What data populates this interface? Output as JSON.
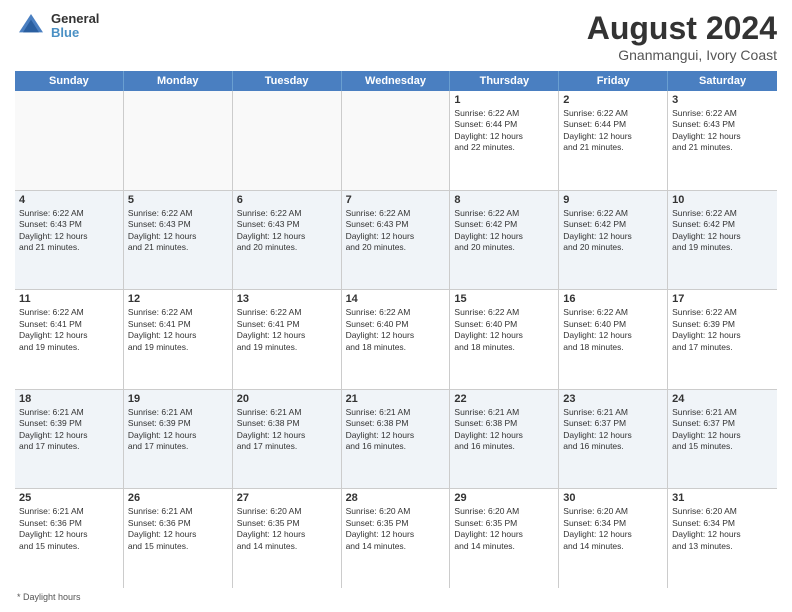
{
  "header": {
    "logo_line1": "General",
    "logo_line2": "Blue",
    "title": "August 2024",
    "subtitle": "Gnanmangui, Ivory Coast"
  },
  "days_of_week": [
    "Sunday",
    "Monday",
    "Tuesday",
    "Wednesday",
    "Thursday",
    "Friday",
    "Saturday"
  ],
  "weeks": [
    [
      {
        "day": "",
        "info": ""
      },
      {
        "day": "",
        "info": ""
      },
      {
        "day": "",
        "info": ""
      },
      {
        "day": "",
        "info": ""
      },
      {
        "day": "1",
        "info": "Sunrise: 6:22 AM\nSunset: 6:44 PM\nDaylight: 12 hours\nand 22 minutes."
      },
      {
        "day": "2",
        "info": "Sunrise: 6:22 AM\nSunset: 6:44 PM\nDaylight: 12 hours\nand 21 minutes."
      },
      {
        "day": "3",
        "info": "Sunrise: 6:22 AM\nSunset: 6:43 PM\nDaylight: 12 hours\nand 21 minutes."
      }
    ],
    [
      {
        "day": "4",
        "info": "Sunrise: 6:22 AM\nSunset: 6:43 PM\nDaylight: 12 hours\nand 21 minutes."
      },
      {
        "day": "5",
        "info": "Sunrise: 6:22 AM\nSunset: 6:43 PM\nDaylight: 12 hours\nand 21 minutes."
      },
      {
        "day": "6",
        "info": "Sunrise: 6:22 AM\nSunset: 6:43 PM\nDaylight: 12 hours\nand 20 minutes."
      },
      {
        "day": "7",
        "info": "Sunrise: 6:22 AM\nSunset: 6:43 PM\nDaylight: 12 hours\nand 20 minutes."
      },
      {
        "day": "8",
        "info": "Sunrise: 6:22 AM\nSunset: 6:42 PM\nDaylight: 12 hours\nand 20 minutes."
      },
      {
        "day": "9",
        "info": "Sunrise: 6:22 AM\nSunset: 6:42 PM\nDaylight: 12 hours\nand 20 minutes."
      },
      {
        "day": "10",
        "info": "Sunrise: 6:22 AM\nSunset: 6:42 PM\nDaylight: 12 hours\nand 19 minutes."
      }
    ],
    [
      {
        "day": "11",
        "info": "Sunrise: 6:22 AM\nSunset: 6:41 PM\nDaylight: 12 hours\nand 19 minutes."
      },
      {
        "day": "12",
        "info": "Sunrise: 6:22 AM\nSunset: 6:41 PM\nDaylight: 12 hours\nand 19 minutes."
      },
      {
        "day": "13",
        "info": "Sunrise: 6:22 AM\nSunset: 6:41 PM\nDaylight: 12 hours\nand 19 minutes."
      },
      {
        "day": "14",
        "info": "Sunrise: 6:22 AM\nSunset: 6:40 PM\nDaylight: 12 hours\nand 18 minutes."
      },
      {
        "day": "15",
        "info": "Sunrise: 6:22 AM\nSunset: 6:40 PM\nDaylight: 12 hours\nand 18 minutes."
      },
      {
        "day": "16",
        "info": "Sunrise: 6:22 AM\nSunset: 6:40 PM\nDaylight: 12 hours\nand 18 minutes."
      },
      {
        "day": "17",
        "info": "Sunrise: 6:22 AM\nSunset: 6:39 PM\nDaylight: 12 hours\nand 17 minutes."
      }
    ],
    [
      {
        "day": "18",
        "info": "Sunrise: 6:21 AM\nSunset: 6:39 PM\nDaylight: 12 hours\nand 17 minutes."
      },
      {
        "day": "19",
        "info": "Sunrise: 6:21 AM\nSunset: 6:39 PM\nDaylight: 12 hours\nand 17 minutes."
      },
      {
        "day": "20",
        "info": "Sunrise: 6:21 AM\nSunset: 6:38 PM\nDaylight: 12 hours\nand 17 minutes."
      },
      {
        "day": "21",
        "info": "Sunrise: 6:21 AM\nSunset: 6:38 PM\nDaylight: 12 hours\nand 16 minutes."
      },
      {
        "day": "22",
        "info": "Sunrise: 6:21 AM\nSunset: 6:38 PM\nDaylight: 12 hours\nand 16 minutes."
      },
      {
        "day": "23",
        "info": "Sunrise: 6:21 AM\nSunset: 6:37 PM\nDaylight: 12 hours\nand 16 minutes."
      },
      {
        "day": "24",
        "info": "Sunrise: 6:21 AM\nSunset: 6:37 PM\nDaylight: 12 hours\nand 15 minutes."
      }
    ],
    [
      {
        "day": "25",
        "info": "Sunrise: 6:21 AM\nSunset: 6:36 PM\nDaylight: 12 hours\nand 15 minutes."
      },
      {
        "day": "26",
        "info": "Sunrise: 6:21 AM\nSunset: 6:36 PM\nDaylight: 12 hours\nand 15 minutes."
      },
      {
        "day": "27",
        "info": "Sunrise: 6:20 AM\nSunset: 6:35 PM\nDaylight: 12 hours\nand 14 minutes."
      },
      {
        "day": "28",
        "info": "Sunrise: 6:20 AM\nSunset: 6:35 PM\nDaylight: 12 hours\nand 14 minutes."
      },
      {
        "day": "29",
        "info": "Sunrise: 6:20 AM\nSunset: 6:35 PM\nDaylight: 12 hours\nand 14 minutes."
      },
      {
        "day": "30",
        "info": "Sunrise: 6:20 AM\nSunset: 6:34 PM\nDaylight: 12 hours\nand 14 minutes."
      },
      {
        "day": "31",
        "info": "Sunrise: 6:20 AM\nSunset: 6:34 PM\nDaylight: 12 hours\nand 13 minutes."
      }
    ]
  ],
  "footer": "Daylight hours"
}
